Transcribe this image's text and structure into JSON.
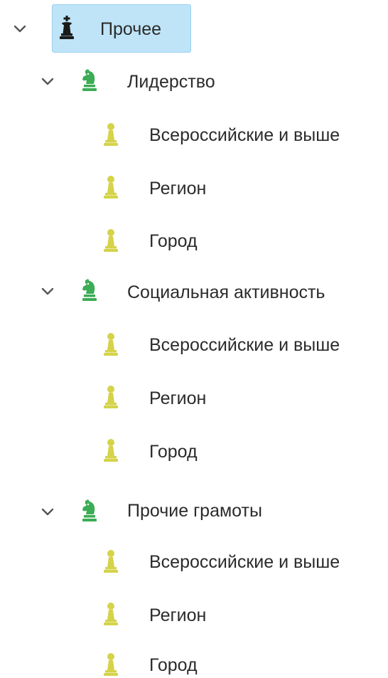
{
  "colors": {
    "selected_bg": "#bfe4f7",
    "selected_border": "#9ad0ee",
    "king_icon": "#1a1a1a",
    "knight_icon": "#3cac55",
    "pawn_icon": "#d4d34a",
    "caret": "#555555",
    "text": "#2b2b2b"
  },
  "icons": {
    "root": "chess-king-icon",
    "group": "chess-knight-icon",
    "leaf": "chess-pawn-icon",
    "expand": "chevron-down-icon"
  },
  "tree": {
    "root": {
      "label": "Прочее",
      "expanded": true,
      "selected": true
    },
    "groups": [
      {
        "label": "Лидерство",
        "expanded": true,
        "children": [
          "Всероссийские и выше",
          "Регион",
          "Город"
        ]
      },
      {
        "label": "Социальная активность",
        "expanded": true,
        "children": [
          "Всероссийские и выше",
          "Регион",
          "Город"
        ]
      },
      {
        "label": "Прочие грамоты",
        "expanded": true,
        "children": [
          "Всероссийские и выше",
          "Регион",
          "Город"
        ]
      }
    ]
  }
}
